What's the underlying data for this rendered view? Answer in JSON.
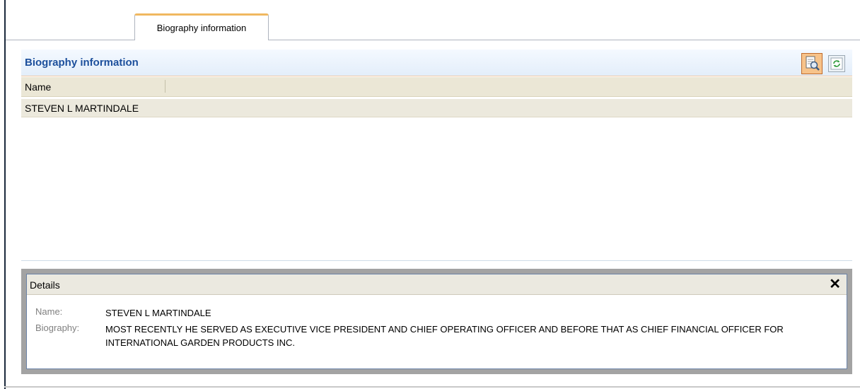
{
  "tabs": [
    {
      "label": "Biography information",
      "active": true
    }
  ],
  "panel": {
    "title": "Biography information",
    "toolbar": {
      "search_icon": "search-icon",
      "refresh_icon": "refresh-icon"
    }
  },
  "grid": {
    "columns": [
      "Name"
    ],
    "rows": [
      {
        "name": "STEVEN L MARTINDALE",
        "selected": true
      }
    ]
  },
  "details": {
    "title": "Details",
    "close_glyph": "✕",
    "name_label": "Name:",
    "name_value": "STEVEN L MARTINDALE",
    "biography_label": "Biography:",
    "biography_value": "MOST RECENTLY HE SERVED AS EXECUTIVE VICE PRESIDENT AND CHIEF OPERATING OFFICER AND BEFORE THAT AS CHIEF FINANCIAL OFFICER FOR INTERNATIONAL GARDEN PRODUCTS INC."
  },
  "colors": {
    "title_blue": "#1c4f9c",
    "tab_accent": "#f0b860",
    "grid_header": "#ebe7d6"
  }
}
